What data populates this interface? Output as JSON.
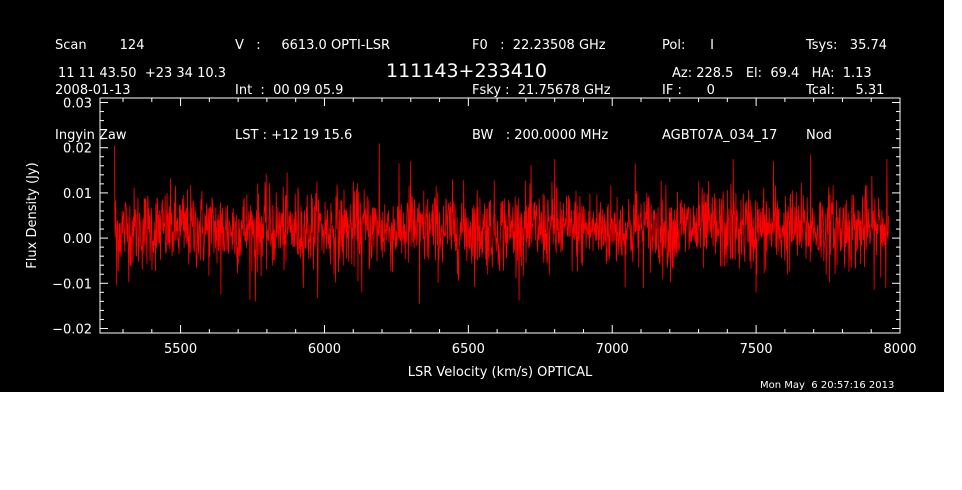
{
  "header": {
    "col1": [
      "Scan        124",
      "2008-01-13",
      "Ingyin Zaw"
    ],
    "col2": [
      "V   :     6613.0 OPTI-LSR",
      "Int  :  00 09 05.9",
      "LST : +12 19 15.6"
    ],
    "col3": [
      "F0   :  22.23508 GHz",
      "Fsky :  21.75678 GHz",
      "BW   : 200.0000 MHz"
    ],
    "col4": [
      "Pol:      I",
      "IF :      0",
      "AGBT07A_034_17"
    ],
    "col5": [
      "Tsys:   35.74",
      "Tcal:     5.31",
      "Nod"
    ],
    "coords": "11 11 43.50  +23 34 10.3",
    "source": "111143+233410",
    "azelha": "Az: 228.5   El:  69.4   HA:  1.13"
  },
  "timestamp": "Mon May  6 20:57:16 2013",
  "chart_data": {
    "type": "line",
    "title": "",
    "xlabel": "LSR Velocity (km/s) OPTICAL",
    "ylabel": "Flux Density (Jy)",
    "xlim": [
      5220,
      8000
    ],
    "ylim": [
      -0.021,
      0.031
    ],
    "xticks": [
      5500,
      6000,
      6500,
      7000,
      7500,
      8000
    ],
    "xtick_labels": [
      "5500",
      "6000",
      "6500",
      "7000",
      "7500",
      "8000"
    ],
    "yticks": [
      -0.02,
      -0.01,
      0.0,
      0.01,
      0.02,
      0.03
    ],
    "ytick_labels": [
      "−0.02",
      "−0.01",
      "0.00",
      "0.01",
      "0.02",
      "0.03"
    ],
    "series": [
      {
        "color": "#ff0000",
        "x_start": 5270,
        "x_end": 7960,
        "mean": 0.002,
        "rms": 0.0045,
        "n_points": 2000,
        "spikes": [
          {
            "x": 5270,
            "y": 0.0205
          },
          {
            "x": 5278,
            "y": -0.0105
          },
          {
            "x": 5640,
            "y": -0.0125
          },
          {
            "x": 5760,
            "y": -0.014
          },
          {
            "x": 6130,
            "y": -0.012
          },
          {
            "x": 6190,
            "y": 0.021
          },
          {
            "x": 6300,
            "y": 0.017
          },
          {
            "x": 6330,
            "y": -0.0145
          },
          {
            "x": 6800,
            "y": 0.0175
          },
          {
            "x": 7080,
            "y": 0.0165
          },
          {
            "x": 7420,
            "y": 0.0175
          },
          {
            "x": 7500,
            "y": -0.012
          },
          {
            "x": 7560,
            "y": 0.017
          },
          {
            "x": 7690,
            "y": 0.0185
          },
          {
            "x": 7955,
            "y": 0.0175
          },
          {
            "x": 7950,
            "y": -0.011
          }
        ]
      }
    ]
  }
}
